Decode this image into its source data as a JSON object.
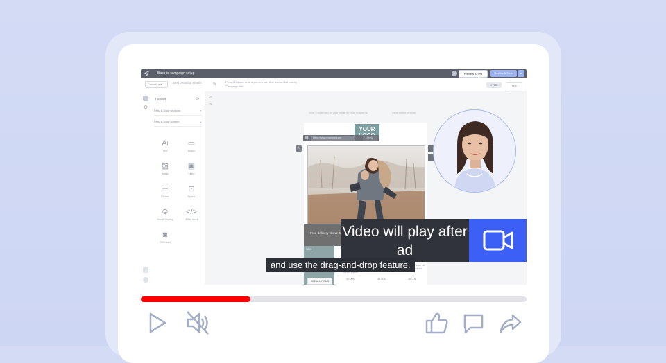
{
  "topbar": {
    "back_label": "Back to campaign setup",
    "preview_label": "Preview & Test",
    "review_label": "Review & Send"
  },
  "subbar": {
    "domain_chip": "Domain a ▾",
    "subject": "Best beautiful emails",
    "preheader_1": "Preset Custom",
    "preheader_2": "write a preview text that is short but catchy",
    "preheader_3": "Campaign title",
    "view_html": "HTML",
    "view_text": "Text"
  },
  "panel": {
    "title": "Layout",
    "sections": [
      "Drag & Drop sections",
      "Drag & Drop content"
    ],
    "blocks": [
      "Text",
      "Button",
      "Image",
      "Video",
      "Divider",
      "Spacer",
      "Social Sharing",
      "HTML block",
      "RSS feed"
    ]
  },
  "canvas": {
    "summary": "Give a summary of your email to your recipients",
    "view_online": "View online version",
    "logo_text": "YOUR LOGO",
    "url_value": "https://www.example.com",
    "url_apply": "Apply",
    "promo_text": "Free delivery above 50€",
    "products": [
      {
        "tag": "NEW",
        "name": "",
        "price": "",
        "shop": "SEE ALL ITEMS"
      },
      {
        "tag": "",
        "name": "Lorem ipsum",
        "price": "$9.00$",
        "shop": ""
      },
      {
        "tag": "",
        "name": "Lorem ipsum dolor sit amet",
        "price": "$6.00$",
        "shop": ""
      },
      {
        "tag": "",
        "name": "Lorem ipsum dolor sit amet consectetur",
        "price": "$8.00$",
        "shop": ""
      }
    ]
  },
  "ad": {
    "message": "Video will play after ad",
    "icon": "video-camera-icon"
  },
  "caption": "and use the drag-and-drop feature.",
  "player": {
    "progress": 0.284,
    "progress_color": "#ff0000",
    "icons": [
      "play-icon",
      "volume-muted-icon",
      "thumbs-up-icon",
      "comment-icon",
      "share-icon"
    ]
  },
  "colors": {
    "background": "#d3dbf5",
    "ad_dark": "#31333b",
    "ad_blue": "#3c5ff5",
    "accent_teal": "#7b9ea0"
  }
}
